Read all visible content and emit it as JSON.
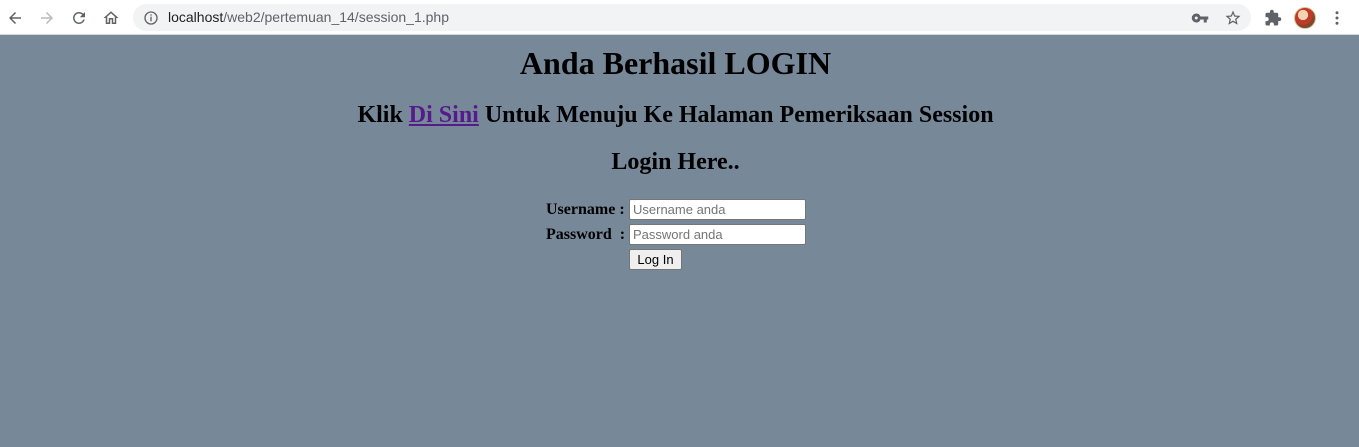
{
  "browser": {
    "url_host": "localhost",
    "url_path": "/web2/pertemuan_14/session_1.php",
    "icons": {
      "back": "arrow-left-icon",
      "forward": "arrow-right-icon",
      "reload": "reload-icon",
      "home": "home-icon",
      "info": "info-icon",
      "key": "key-icon",
      "star": "star-icon",
      "extensions": "puzzle-icon",
      "menu": "kebab-menu-icon"
    }
  },
  "page": {
    "background": "#778899",
    "heading": "Anda Berhasil LOGIN",
    "link_prefix": "Klik ",
    "link_text": "Di Sini",
    "link_suffix": " Untuk Menuju Ke Halaman Pemeriksaan Session",
    "login_heading": "Login Here..",
    "form": {
      "username_label": "Username :",
      "username_placeholder": "Username anda",
      "password_label": "Password  :",
      "password_placeholder": "Password anda",
      "submit_label": "Log In"
    }
  }
}
